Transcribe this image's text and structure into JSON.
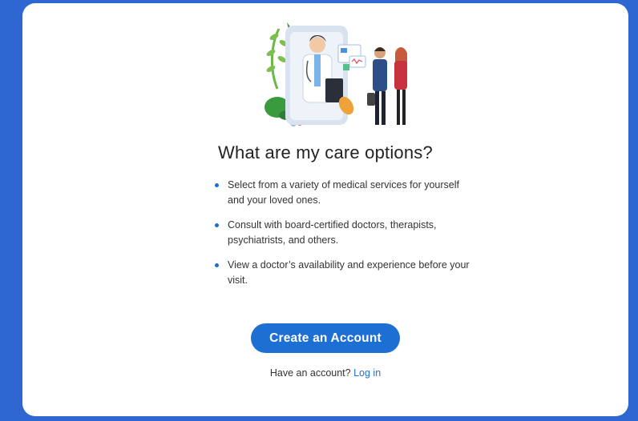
{
  "page": {
    "title": "What are my care options?",
    "bullets": [
      "Select from a variety of medical services for yourself and your loved ones.",
      "Consult with board-certified doctors, therapists, psychiatrists, and others.",
      "View a doctor’s availability and experience before your visit."
    ],
    "cta_label": "Create an Account",
    "login_prompt": "Have an account?",
    "login_link": "Log in"
  },
  "colors": {
    "background": "#2e67d2",
    "card": "#ffffff",
    "accent": "#1e6fd3",
    "bullet": "#1b6fc8"
  },
  "icons": [
    "doctor-telehealth-illustration"
  ]
}
